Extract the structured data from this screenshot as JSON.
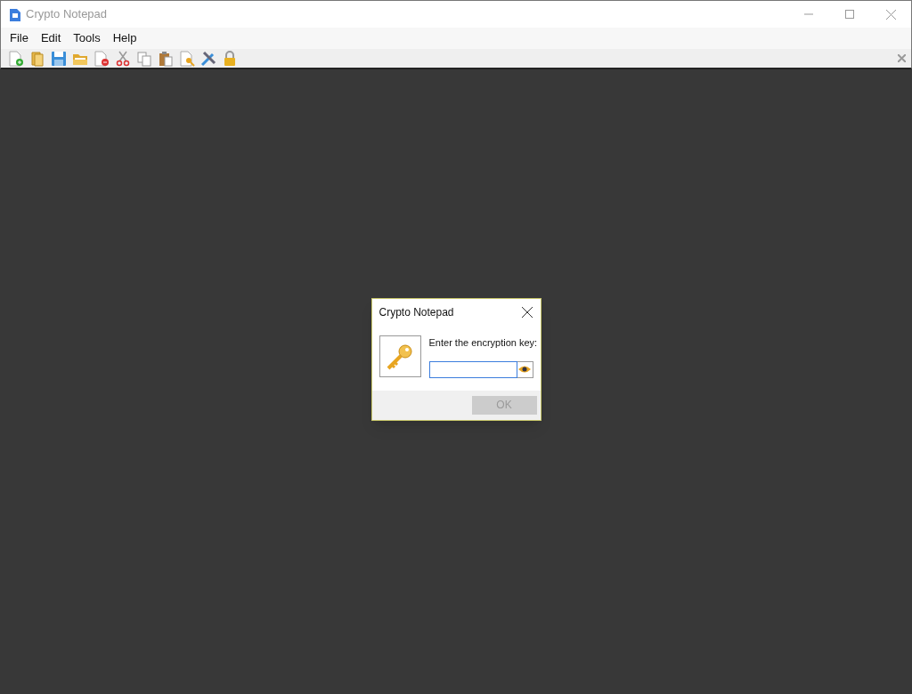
{
  "window": {
    "title": "Crypto Notepad"
  },
  "menu": [
    "File",
    "Edit",
    "Tools",
    "Help"
  ],
  "dialog": {
    "title": "Crypto Notepad",
    "prompt": "Enter the encryption key:",
    "ok_button": {
      "label": "OK",
      "disabled": true
    }
  }
}
